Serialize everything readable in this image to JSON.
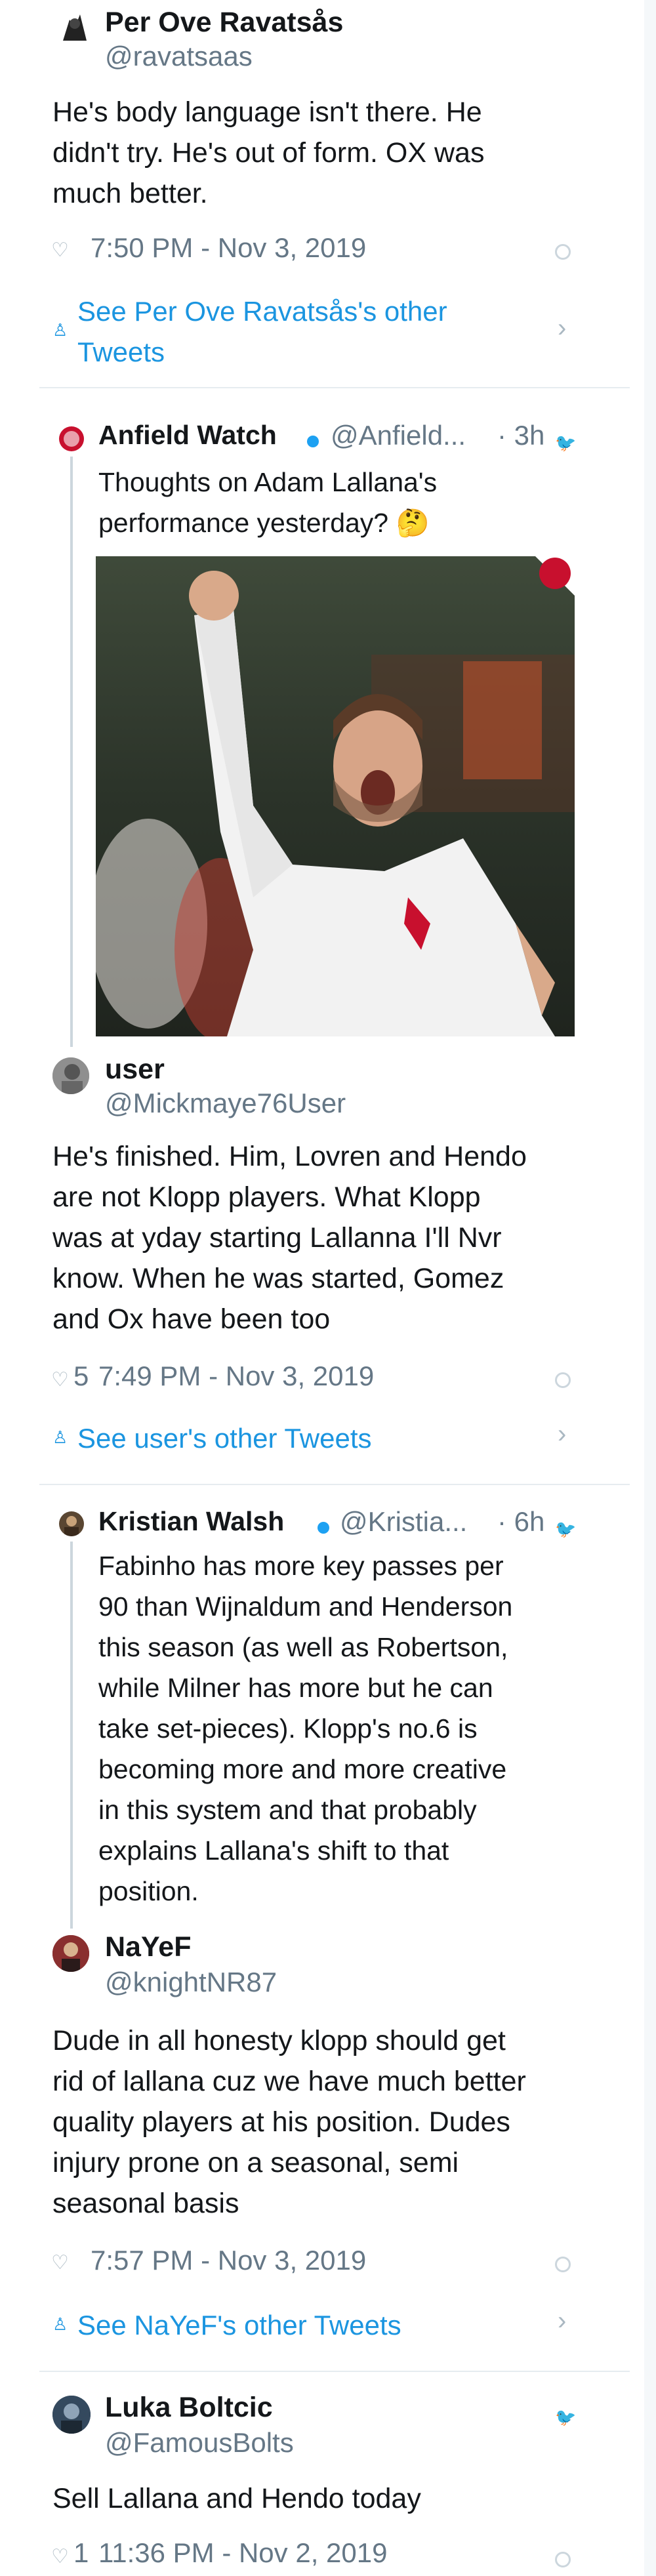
{
  "tweet1": {
    "name": "Per Ove Ravatsås",
    "handle": "@ravatsaas",
    "lines": [
      "He's body language isn't there. He",
      "didn't try. He's out of form. OX was",
      "much better."
    ],
    "likes": "",
    "timestamp": "7:50 PM - Nov 3, 2019",
    "see_other": [
      "See Per Ove Ravatsås's other",
      "Tweets"
    ]
  },
  "quote1": {
    "name": "Anfield Watch",
    "handle": "@Anfield...",
    "age": "· 3h",
    "lines": [
      "Thoughts on Adam Lallana's",
      "performance yesterday? 🤔"
    ]
  },
  "tweet2": {
    "name": "user",
    "handle": "@Mickmaye76User",
    "lines": [
      "He's finished. Him, Lovren and Hendo",
      "are not Klopp players. What Klopp",
      "was at yday starting Lallanna I'll Nvr",
      "know. When he was started, Gomez",
      "and Ox have been too"
    ],
    "likes": "5",
    "timestamp": "7:49 PM - Nov 3, 2019",
    "see_other": "See user's other Tweets"
  },
  "quote2": {
    "name": "Kristian Walsh",
    "handle": "@Kristia...",
    "age": "· 6h",
    "lines": [
      "Fabinho has more key passes per",
      "90 than Wijnaldum and Henderson",
      "this season (as well as Robertson,",
      "while Milner has more but he can",
      "take set-pieces). Klopp's no.6 is",
      "becoming more and more creative",
      "in this system and that probably",
      "explains Lallana's shift to that",
      "position."
    ]
  },
  "tweet3": {
    "name": "NaYeF",
    "handle": "@knightNR87",
    "lines": [
      "Dude in all honesty klopp should get",
      "rid of lallana cuz we have much better",
      "quality players at his position. Dudes",
      "injury prone on a seasonal, semi",
      "seasonal basis"
    ],
    "likes": "",
    "timestamp": "7:57 PM - Nov 3, 2019",
    "see_other": "See NaYeF's other Tweets"
  },
  "tweet4": {
    "name": "Luka Boltcic",
    "handle": "@FamousBolts",
    "lines": [
      "Sell Lallana and Hendo today"
    ],
    "likes": "1",
    "timestamp": "11:36 PM - Nov 2, 2019"
  },
  "icons": {
    "heart": "heart-icon",
    "info": "info-icon",
    "person": "person-icon",
    "chevron": "chevron-right-icon",
    "bird": "twitter-bird-icon",
    "verified": "verified-badge-icon"
  },
  "colors": {
    "link": "#1b95e0",
    "muted": "#657786",
    "text": "#14171a",
    "thread": "#ccd6dd"
  }
}
